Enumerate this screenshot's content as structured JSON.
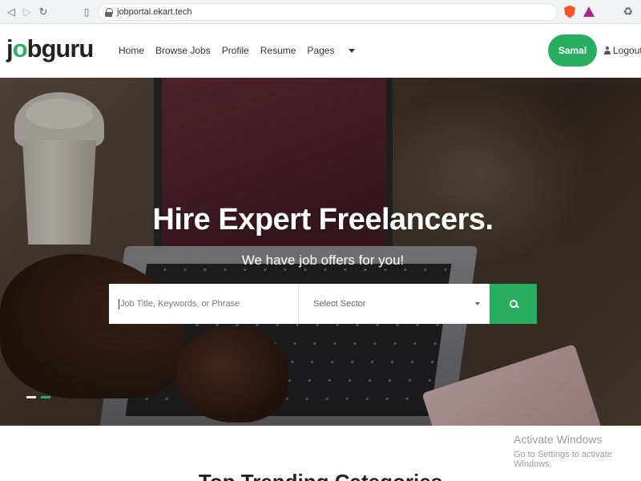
{
  "browser": {
    "url": "jobportal.ekart.tech",
    "icons": [
      "back-icon",
      "forward-icon",
      "reload-icon",
      "bookmark-icon",
      "lock-icon",
      "brave-shield-icon",
      "brave-rewards-icon",
      "extensions-icon"
    ]
  },
  "header": {
    "logo_prefix": "j",
    "logo_accent": "o",
    "logo_suffix": "bguru",
    "nav": {
      "home": "Home",
      "browse_jobs": "Browse Jobs",
      "profile": "Profile",
      "resume": "Resume",
      "pages": "Pages"
    },
    "user_button": "Samal",
    "logout": "Logout"
  },
  "hero": {
    "title": "Hire Expert Freelancers.",
    "subtitle": "We have job offers for you!",
    "search": {
      "keyword_placeholder": "Job Title, Keywords, or Phrase",
      "sector_select": "Select Sector"
    },
    "slides_total": 2,
    "slide_active": 2
  },
  "windows_watermark": {
    "title": "Activate Windows",
    "subtitle": "Go to Settings to activate Windows."
  },
  "section": {
    "title": "Top Trending Categories"
  },
  "colors": {
    "accent": "#27ae60",
    "text": "#333333"
  }
}
